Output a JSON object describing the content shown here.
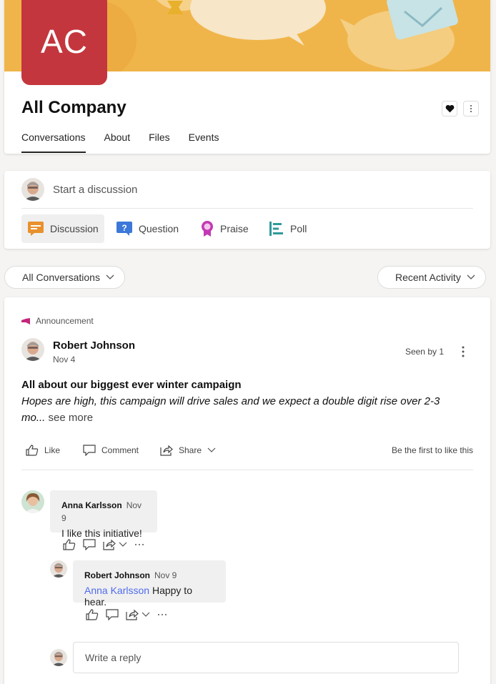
{
  "group": {
    "logo_initials": "AC",
    "title": "All Company",
    "tabs": [
      "Conversations",
      "About",
      "Files",
      "Events"
    ],
    "favorite_icon": "heart-icon",
    "more_icon": "more-vertical-icon"
  },
  "composer": {
    "prompt": "Start a discussion",
    "post_types": [
      {
        "label": "Discussion",
        "icon": "discussion-icon",
        "color": "#e8912d"
      },
      {
        "label": "Question",
        "icon": "question-icon",
        "color": "#3b78d8"
      },
      {
        "label": "Praise",
        "icon": "praise-icon",
        "color": "#c239b3"
      },
      {
        "label": "Poll",
        "icon": "poll-icon",
        "color": "#2f9a9a"
      }
    ]
  },
  "filters": {
    "conversations": "All Conversations",
    "sort": "Recent Activity"
  },
  "post": {
    "tag": "Announcement",
    "author": "Robert Johnson",
    "date": "Nov 4",
    "seen_by": "Seen by 1",
    "title": "All about our biggest ever winter campaign",
    "body": "Hopes are high, this campaign will drive sales and we expect a double digit rise over 2-3 mo...",
    "see_more": "see more",
    "actions": {
      "like": "Like",
      "comment": "Comment",
      "share": "Share"
    },
    "like_status": "Be the first to like this"
  },
  "comments": [
    {
      "author": "Anna Karlsson",
      "date": "Nov 9",
      "text": "I like this initiative!"
    },
    {
      "author": "Robert Johnson",
      "date": "Nov 9",
      "mention": "Anna Karlsson",
      "text": "Happy to hear."
    }
  ],
  "reply": {
    "placeholder": "Write a reply"
  },
  "colors": {
    "banner": "#f0b54a",
    "logo": "#c4363d",
    "announcement": "#c4267a",
    "mention": "#4f6bed"
  }
}
